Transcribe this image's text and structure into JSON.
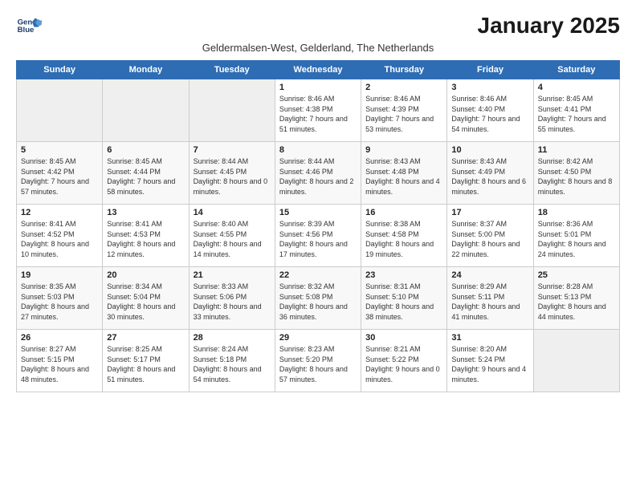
{
  "logo": {
    "line1": "General",
    "line2": "Blue"
  },
  "title": "January 2025",
  "subtitle": "Geldermalsen-West, Gelderland, The Netherlands",
  "weekdays": [
    "Sunday",
    "Monday",
    "Tuesday",
    "Wednesday",
    "Thursday",
    "Friday",
    "Saturday"
  ],
  "weeks": [
    [
      {
        "day": "",
        "empty": true
      },
      {
        "day": "",
        "empty": true
      },
      {
        "day": "",
        "empty": true
      },
      {
        "day": "1",
        "rise": "8:46 AM",
        "set": "4:38 PM",
        "daylight": "7 hours and 51 minutes."
      },
      {
        "day": "2",
        "rise": "8:46 AM",
        "set": "4:39 PM",
        "daylight": "7 hours and 53 minutes."
      },
      {
        "day": "3",
        "rise": "8:46 AM",
        "set": "4:40 PM",
        "daylight": "7 hours and 54 minutes."
      },
      {
        "day": "4",
        "rise": "8:45 AM",
        "set": "4:41 PM",
        "daylight": "7 hours and 55 minutes."
      }
    ],
    [
      {
        "day": "5",
        "rise": "8:45 AM",
        "set": "4:42 PM",
        "daylight": "7 hours and 57 minutes."
      },
      {
        "day": "6",
        "rise": "8:45 AM",
        "set": "4:44 PM",
        "daylight": "7 hours and 58 minutes."
      },
      {
        "day": "7",
        "rise": "8:44 AM",
        "set": "4:45 PM",
        "daylight": "8 hours and 0 minutes."
      },
      {
        "day": "8",
        "rise": "8:44 AM",
        "set": "4:46 PM",
        "daylight": "8 hours and 2 minutes."
      },
      {
        "day": "9",
        "rise": "8:43 AM",
        "set": "4:48 PM",
        "daylight": "8 hours and 4 minutes."
      },
      {
        "day": "10",
        "rise": "8:43 AM",
        "set": "4:49 PM",
        "daylight": "8 hours and 6 minutes."
      },
      {
        "day": "11",
        "rise": "8:42 AM",
        "set": "4:50 PM",
        "daylight": "8 hours and 8 minutes."
      }
    ],
    [
      {
        "day": "12",
        "rise": "8:41 AM",
        "set": "4:52 PM",
        "daylight": "8 hours and 10 minutes."
      },
      {
        "day": "13",
        "rise": "8:41 AM",
        "set": "4:53 PM",
        "daylight": "8 hours and 12 minutes."
      },
      {
        "day": "14",
        "rise": "8:40 AM",
        "set": "4:55 PM",
        "daylight": "8 hours and 14 minutes."
      },
      {
        "day": "15",
        "rise": "8:39 AM",
        "set": "4:56 PM",
        "daylight": "8 hours and 17 minutes."
      },
      {
        "day": "16",
        "rise": "8:38 AM",
        "set": "4:58 PM",
        "daylight": "8 hours and 19 minutes."
      },
      {
        "day": "17",
        "rise": "8:37 AM",
        "set": "5:00 PM",
        "daylight": "8 hours and 22 minutes."
      },
      {
        "day": "18",
        "rise": "8:36 AM",
        "set": "5:01 PM",
        "daylight": "8 hours and 24 minutes."
      }
    ],
    [
      {
        "day": "19",
        "rise": "8:35 AM",
        "set": "5:03 PM",
        "daylight": "8 hours and 27 minutes."
      },
      {
        "day": "20",
        "rise": "8:34 AM",
        "set": "5:04 PM",
        "daylight": "8 hours and 30 minutes."
      },
      {
        "day": "21",
        "rise": "8:33 AM",
        "set": "5:06 PM",
        "daylight": "8 hours and 33 minutes."
      },
      {
        "day": "22",
        "rise": "8:32 AM",
        "set": "5:08 PM",
        "daylight": "8 hours and 36 minutes."
      },
      {
        "day": "23",
        "rise": "8:31 AM",
        "set": "5:10 PM",
        "daylight": "8 hours and 38 minutes."
      },
      {
        "day": "24",
        "rise": "8:29 AM",
        "set": "5:11 PM",
        "daylight": "8 hours and 41 minutes."
      },
      {
        "day": "25",
        "rise": "8:28 AM",
        "set": "5:13 PM",
        "daylight": "8 hours and 44 minutes."
      }
    ],
    [
      {
        "day": "26",
        "rise": "8:27 AM",
        "set": "5:15 PM",
        "daylight": "8 hours and 48 minutes."
      },
      {
        "day": "27",
        "rise": "8:25 AM",
        "set": "5:17 PM",
        "daylight": "8 hours and 51 minutes."
      },
      {
        "day": "28",
        "rise": "8:24 AM",
        "set": "5:18 PM",
        "daylight": "8 hours and 54 minutes."
      },
      {
        "day": "29",
        "rise": "8:23 AM",
        "set": "5:20 PM",
        "daylight": "8 hours and 57 minutes."
      },
      {
        "day": "30",
        "rise": "8:21 AM",
        "set": "5:22 PM",
        "daylight": "9 hours and 0 minutes."
      },
      {
        "day": "31",
        "rise": "8:20 AM",
        "set": "5:24 PM",
        "daylight": "9 hours and 4 minutes."
      },
      {
        "day": "",
        "empty": true
      }
    ]
  ]
}
